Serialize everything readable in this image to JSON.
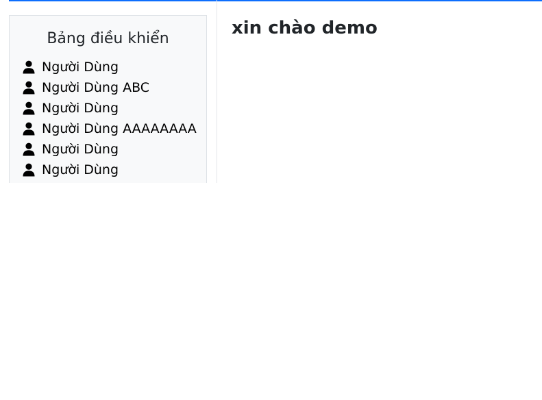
{
  "theme": {
    "accent": "#0d6efd",
    "sidebar_bg": "#f8f9fa",
    "border": "#dee2e6"
  },
  "sidebar": {
    "title": "Bảng điều khiển",
    "items": [
      {
        "label": "Người Dùng",
        "icon": "user-icon"
      },
      {
        "label": "Người Dùng ABC",
        "icon": "user-icon"
      },
      {
        "label": "Người Dùng",
        "icon": "user-icon"
      },
      {
        "label": "Người Dùng AAAAAAAA",
        "icon": "user-icon"
      },
      {
        "label": "Người Dùng",
        "icon": "user-icon"
      },
      {
        "label": "Người Dùng",
        "icon": "user-icon"
      }
    ]
  },
  "main": {
    "title": "xin chào demo"
  }
}
